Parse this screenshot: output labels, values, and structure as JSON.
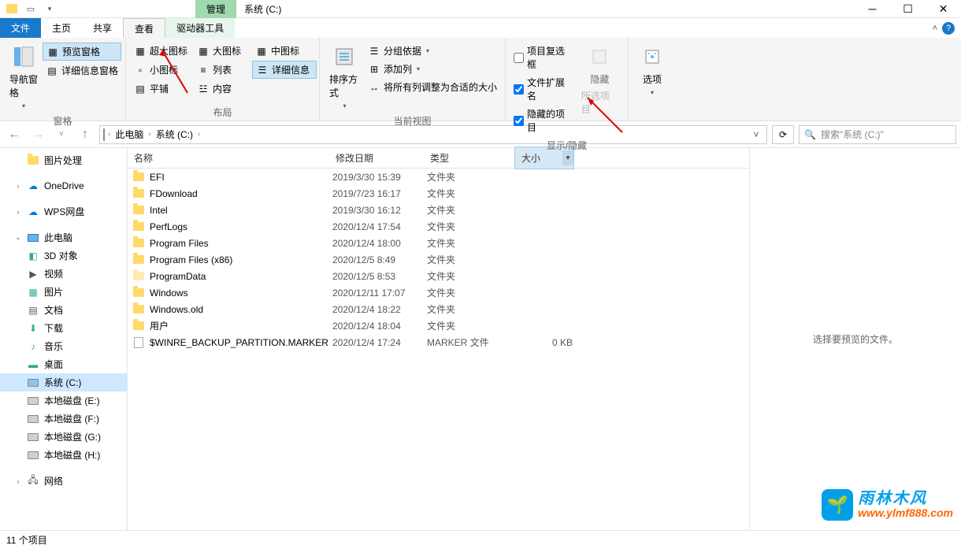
{
  "titlebar": {
    "contextual_label": "管理",
    "title": "系统 (C:)"
  },
  "tabs": {
    "file": "文件",
    "home": "主页",
    "share": "共享",
    "view": "查看",
    "drive_tools": "驱动器工具"
  },
  "ribbon": {
    "panes_group": "窗格",
    "nav_pane": "导航窗格",
    "preview_pane": "预览窗格",
    "details_pane": "详细信息窗格",
    "layout_group": "布局",
    "extra_large_icons": "超大图标",
    "large_icons": "大图标",
    "medium_icons": "中图标",
    "small_icons": "小图标",
    "list": "列表",
    "details": "详细信息",
    "tiles": "平铺",
    "content": "内容",
    "current_view_group": "当前视图",
    "sort_by": "排序方式",
    "group_by": "分组依据",
    "add_columns": "添加列",
    "size_all_columns": "将所有列调整为合适的大小",
    "show_hide_group": "显示/隐藏",
    "item_checkboxes": "项目复选框",
    "file_ext": "文件扩展名",
    "hidden_items": "隐藏的项目",
    "hide_selected": "隐藏",
    "hide_selected_sub": "所选项目",
    "options": "选项"
  },
  "addr": {
    "this_pc": "此电脑",
    "current": "系统 (C:)",
    "search_placeholder": "搜索\"系统 (C:)\""
  },
  "columns": {
    "name": "名称",
    "date": "修改日期",
    "type": "类型",
    "size": "大小"
  },
  "rows": [
    {
      "name": "EFI",
      "date": "2019/3/30 15:39",
      "type": "文件夹",
      "size": "",
      "icon": "folder"
    },
    {
      "name": "FDownload",
      "date": "2019/7/23 16:17",
      "type": "文件夹",
      "size": "",
      "icon": "folder"
    },
    {
      "name": "Intel",
      "date": "2019/3/30 16:12",
      "type": "文件夹",
      "size": "",
      "icon": "folder"
    },
    {
      "name": "PerfLogs",
      "date": "2020/12/4 17:54",
      "type": "文件夹",
      "size": "",
      "icon": "folder"
    },
    {
      "name": "Program Files",
      "date": "2020/12/4 18:00",
      "type": "文件夹",
      "size": "",
      "icon": "folder"
    },
    {
      "name": "Program Files (x86)",
      "date": "2020/12/5 8:49",
      "type": "文件夹",
      "size": "",
      "icon": "folder"
    },
    {
      "name": "ProgramData",
      "date": "2020/12/5 8:53",
      "type": "文件夹",
      "size": "",
      "icon": "folder-light"
    },
    {
      "name": "Windows",
      "date": "2020/12/11 17:07",
      "type": "文件夹",
      "size": "",
      "icon": "folder"
    },
    {
      "name": "Windows.old",
      "date": "2020/12/4 18:22",
      "type": "文件夹",
      "size": "",
      "icon": "folder"
    },
    {
      "name": "用户",
      "date": "2020/12/4 18:04",
      "type": "文件夹",
      "size": "",
      "icon": "folder"
    },
    {
      "name": "$WINRE_BACKUP_PARTITION.MARKER",
      "date": "2020/12/4 17:24",
      "type": "MARKER 文件",
      "size": "0 KB",
      "icon": "file"
    }
  ],
  "sidebar": {
    "photo_process": "图片处理",
    "onedrive": "OneDrive",
    "wps": "WPS网盘",
    "this_pc": "此电脑",
    "obj3d": "3D 对象",
    "videos": "视频",
    "pictures": "图片",
    "documents": "文档",
    "downloads": "下载",
    "music": "音乐",
    "desktop": "桌面",
    "system_c": "系统 (C:)",
    "local_e": "本地磁盘 (E:)",
    "local_f": "本地磁盘 (F:)",
    "local_g": "本地磁盘 (G:)",
    "local_h": "本地磁盘 (H:)",
    "network": "网络"
  },
  "preview": {
    "empty_text": "选择要预览的文件。"
  },
  "status": {
    "item_count": "11 个项目"
  },
  "watermark": {
    "cn": "雨林木风",
    "url": "www.ylmf888.com"
  }
}
